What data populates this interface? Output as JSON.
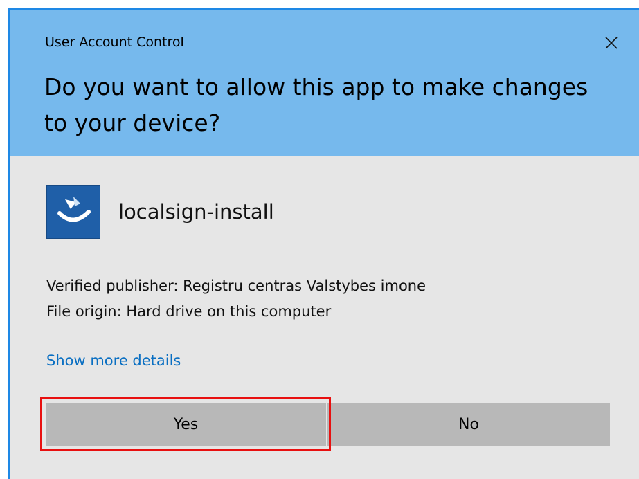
{
  "dialog": {
    "window_title": "User Account Control",
    "question": "Do you want to allow this app to make changes to your device?",
    "close_icon": "close-icon",
    "colors": {
      "header_bg": "#76b9ed",
      "body_bg": "#e6e6e6",
      "accent_border": "#1e88e5",
      "link": "#0a6fc2",
      "button_bg": "#b8b8b8",
      "highlight": "#e81010"
    }
  },
  "app": {
    "icon": "app-logo-icon",
    "name": "localsign-install"
  },
  "details": {
    "publisher": "Verified publisher: Registru centras Valstybes imone",
    "origin": "File origin: Hard drive on this computer",
    "more_link": "Show more details"
  },
  "buttons": {
    "yes": "Yes",
    "no": "No"
  }
}
